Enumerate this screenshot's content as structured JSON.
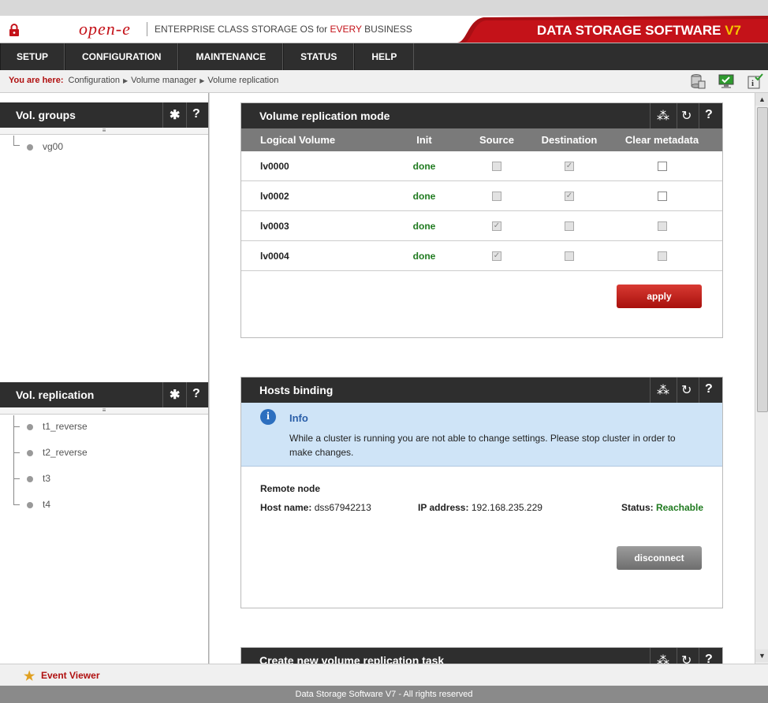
{
  "header": {
    "logo": "open-e",
    "tagline_pre": "ENTERPRISE CLASS STORAGE OS for ",
    "tagline_em": "EVERY",
    "tagline_post": " BUSINESS",
    "brand": "DATA STORAGE SOFTWARE ",
    "brand_version": "V7"
  },
  "nav": [
    "SETUP",
    "CONFIGURATION",
    "MAINTENANCE",
    "STATUS",
    "HELP"
  ],
  "breadcrumb": {
    "prefix": "You are here:",
    "items": [
      "Configuration",
      "Volume manager",
      "Volume replication"
    ]
  },
  "vol_groups": {
    "title": "Vol. groups",
    "items": [
      "vg00"
    ]
  },
  "vol_replication": {
    "title": "Vol. replication",
    "items": [
      "t1_reverse",
      "t2_reverse",
      "t3",
      "t4"
    ]
  },
  "replication_mode": {
    "title": "Volume replication mode",
    "columns": [
      "Logical Volume",
      "Init",
      "Source",
      "Destination",
      "Clear metadata"
    ],
    "rows": [
      {
        "lv": "lv0000",
        "init": "done",
        "source": false,
        "destination": true,
        "clear": false
      },
      {
        "lv": "lv0002",
        "init": "done",
        "source": false,
        "destination": true,
        "clear": false
      },
      {
        "lv": "lv0003",
        "init": "done",
        "source": true,
        "destination": false,
        "clear": false
      },
      {
        "lv": "lv0004",
        "init": "done",
        "source": true,
        "destination": false,
        "clear": false
      }
    ],
    "apply_label": "apply"
  },
  "hosts_binding": {
    "title": "Hosts binding",
    "info_title": "Info",
    "info_text": "While a cluster is running you are not able to change settings. Please stop cluster in order to make changes.",
    "remote_node_label": "Remote node",
    "host_name_label": "Host name",
    "host_name": "dss67942213",
    "ip_label": "IP address",
    "ip": "192.168.235.229",
    "status_label": "Status",
    "status": "Reachable",
    "disconnect_label": "disconnect"
  },
  "new_task": {
    "title": "Create new volume replication task"
  },
  "event_viewer": "Event Viewer",
  "footer": "Data Storage Software V7 - All rights reserved",
  "colors": {
    "accent": "#c41219",
    "ok": "#1f7a1f",
    "bar": "#2e2e2e"
  }
}
